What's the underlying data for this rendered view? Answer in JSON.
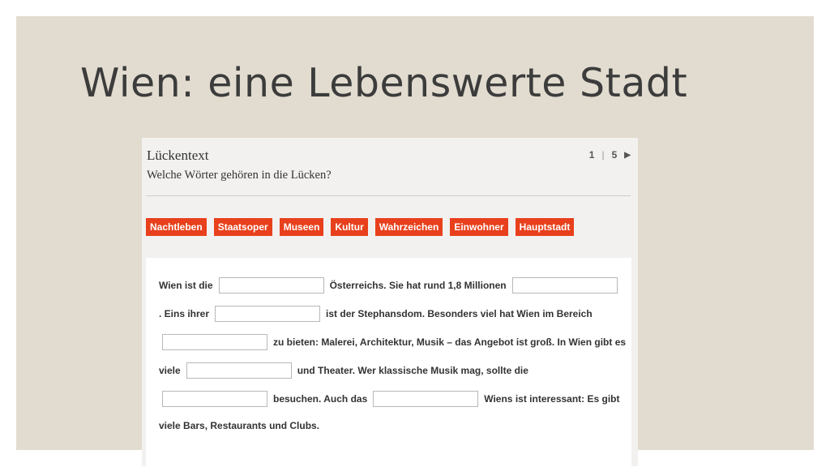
{
  "slide": {
    "title": "Wien: eine Lebenswerte Stadt"
  },
  "widget": {
    "title": "Lückentext",
    "subtitle": "Welche Wörter gehören in die Lücken?",
    "pager": {
      "current": "1",
      "separator": "|",
      "total": "5",
      "next_icon": "▶"
    },
    "chips": [
      "Nachtleben",
      "Staatsoper",
      "Museen",
      "Kultur",
      "Wahrzeichen",
      "Einwohner",
      "Hauptstadt"
    ],
    "text": {
      "l1a": "Wien ist die",
      "l1b": "Österreichs. Sie hat rund 1,8 Millionen",
      "l2a": ". Eins ihrer",
      "l2b": "ist der Stephansdom. Besonders viel hat Wien im Bereich",
      "l3a": "zu bieten: Malerei, Architektur, Musik – das Angebot ist groß. In Wien gibt es",
      "l4a": "viele",
      "l4b": "und Theater. Wer klassische Musik mag, sollte die",
      "l5a": "besuchen. Auch das",
      "l5b": "Wiens ist interessant: Es gibt",
      "l6a": "viele Bars, Restaurants und Clubs."
    }
  }
}
